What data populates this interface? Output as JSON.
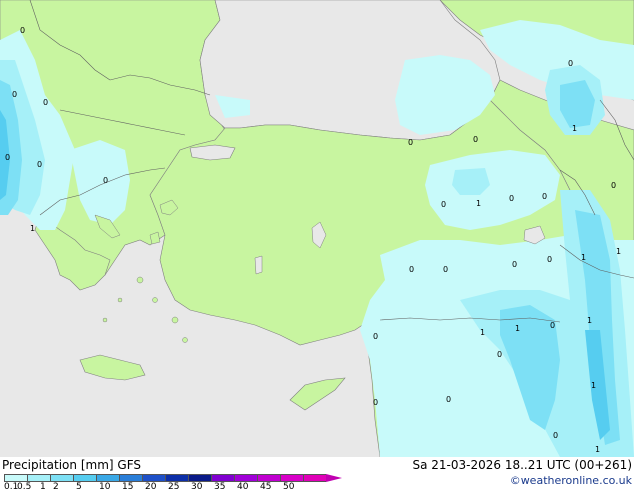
{
  "legend": {
    "title": "Precipitation [mm]",
    "model": "GFS",
    "ticks": [
      "0.1",
      "0.5",
      "1",
      "2",
      "5",
      "10",
      "15",
      "20",
      "25",
      "30",
      "35",
      "40",
      "45",
      "50"
    ],
    "colors": [
      "#c8fafa",
      "#a6f0f8",
      "#7de0f5",
      "#56cdf0",
      "#3aa8e6",
      "#2a7ed8",
      "#1e50c8",
      "#0d2fa8",
      "#0a1a88",
      "#8000d0",
      "#a000d8",
      "#c000d0",
      "#d800c8",
      "#e000b8"
    ]
  },
  "header": {
    "timestamp": "Sa 21-03-2026 18..21 UTC (00+261)"
  },
  "credit": {
    "text": "©weatheronline.co.uk"
  },
  "map": {
    "colors": {
      "sea": "#e8e8e8",
      "land_dry": "#c8f5a0",
      "precip_light": "#c8fafa",
      "precip_1": "#a6f0f8",
      "precip_2": "#7de0f5",
      "precip_5": "#56cdf0",
      "border": "#606060",
      "coast": "#707070"
    },
    "amount_labels": [
      "0",
      "0",
      "0",
      "0",
      "0",
      "0",
      "1",
      "0",
      "0",
      "1",
      "0",
      "0",
      "0",
      "0",
      "0",
      "1",
      "0",
      "0",
      "0",
      "0",
      "1",
      "1",
      "0",
      "1",
      "0",
      "1",
      "0",
      "1",
      "1",
      "0",
      "0",
      "0",
      "1"
    ]
  }
}
